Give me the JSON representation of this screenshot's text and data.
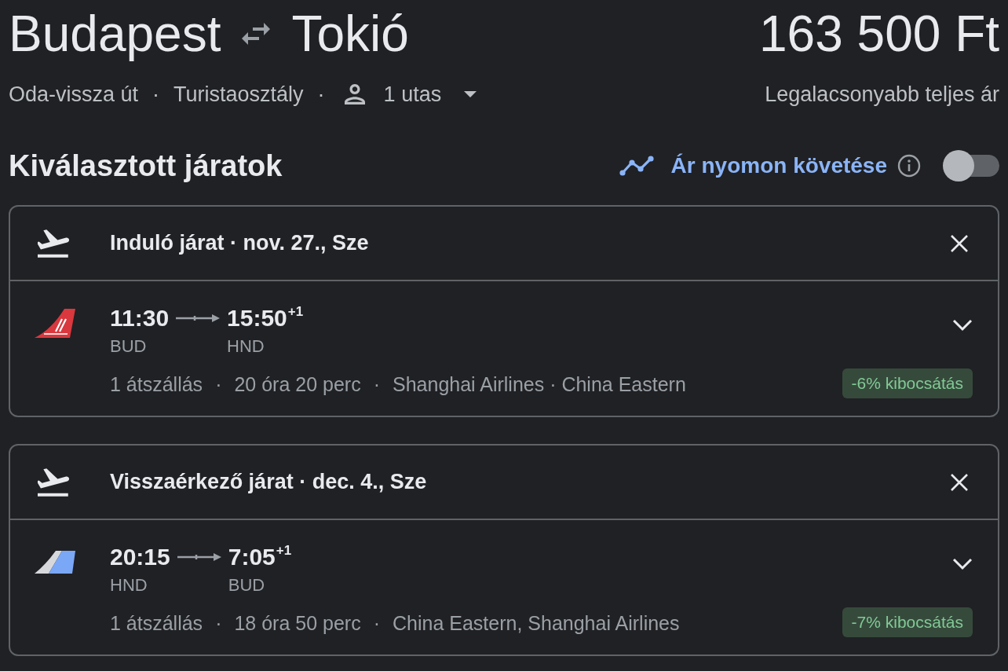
{
  "trip": {
    "origin": "Budapest",
    "destination": "Tokió",
    "price": "163 500 Ft",
    "details": [
      "Oda-vissza út",
      "·",
      "Turistaosztály",
      "·"
    ],
    "passengers": "1 utas",
    "price_note": "Legalacsonyabb teljes ár"
  },
  "selected_flights": {
    "title": "Kiválasztott járatok",
    "price_tracking": {
      "label": "Ár nyomon követése",
      "on": false
    },
    "flights": [
      {
        "title": "Induló járat · nov. 27., Sze",
        "logo": {
          "kind": "red-tail"
        },
        "departure_time": "11:30",
        "departure_airport": "BUD",
        "arrival_time": "15:50",
        "arrival_day_offset": "+1",
        "arrival_airport": "HND",
        "details": [
          "1 átszállás",
          "·",
          "20 óra 20 perc",
          "·",
          "Shanghai Airlines · China Eastern"
        ],
        "emissions": "-6% kibocsátás",
        "expanded": false
      },
      {
        "title": "Visszaérkező járat · dec. 4., Sze",
        "logo": {
          "kind": "duo-tail"
        },
        "departure_time": "20:15",
        "departure_airport": "HND",
        "arrival_time": "7:05",
        "arrival_day_offset": "+1",
        "arrival_airport": "BUD",
        "details": [
          "1 átszállás",
          "·",
          "18 óra 50 perc",
          "·",
          "China Eastern, Shanghai Airlines"
        ],
        "emissions": "-7% kibocsátás",
        "expanded": false
      }
    ]
  }
}
